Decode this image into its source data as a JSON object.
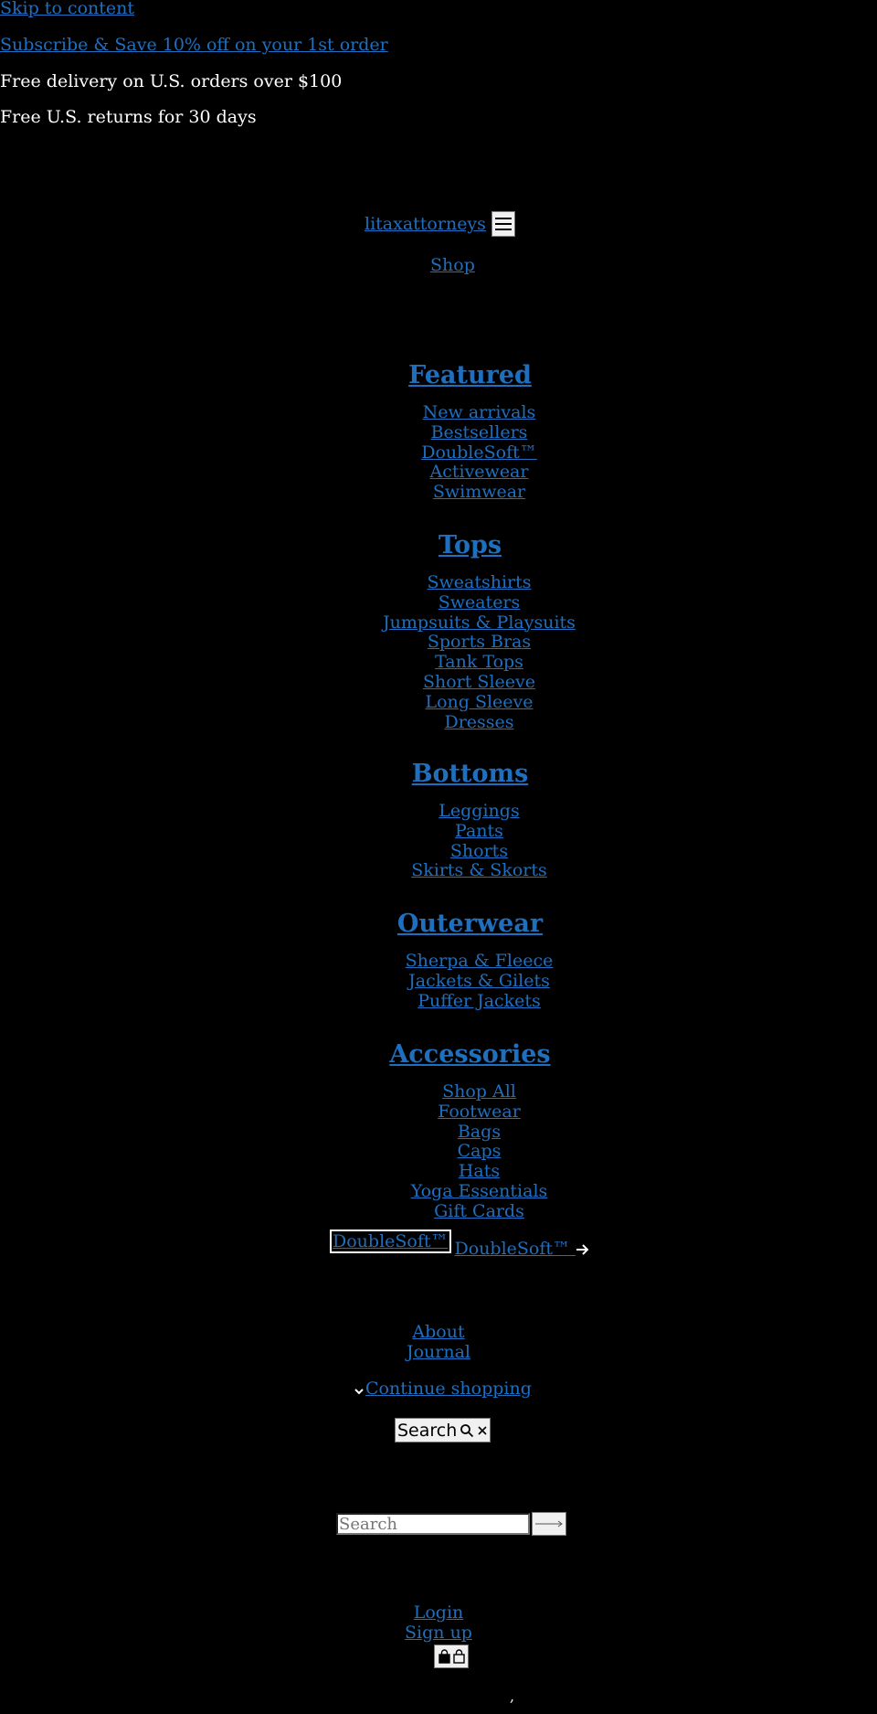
{
  "header": {
    "skip_link": "Skip to content",
    "subscribe_link": "Subscribe & Save 10% off on your 1st order",
    "delivery_text": "Free delivery on U.S. orders over $100",
    "returns_text": "Free U.S. returns for 30 days"
  },
  "brand": {
    "logo_text": "litaxattorneys",
    "menu_icon": "hamburger-icon"
  },
  "nav": {
    "shop_label": "Shop",
    "groups": [
      {
        "title": "Featured",
        "items": [
          "New arrivals",
          "Bestsellers",
          "DoubleSoft™",
          "Activewear",
          "Swimwear"
        ]
      },
      {
        "title": "Tops",
        "items": [
          "Sweatshirts",
          "Sweaters",
          "Jumpsuits & Playsuits",
          "Sports Bras",
          "Tank Tops",
          "Short Sleeve",
          "Long Sleeve",
          "Dresses"
        ]
      },
      {
        "title": "Bottoms",
        "items": [
          "Leggings",
          "Pants",
          "Shorts",
          "Skirts & Skorts"
        ]
      },
      {
        "title": "Outerwear",
        "items": [
          "Sherpa & Fleece",
          "Jackets & Gilets",
          "Puffer Jackets"
        ]
      },
      {
        "title": "Accessories",
        "items": [
          "Shop All",
          "Footwear",
          "Bags",
          "Caps",
          "Hats",
          "Yoga Essentials",
          "Gift Cards"
        ]
      }
    ],
    "promo_image_alt": "DoubleSoft™",
    "promo_link": "DoubleSoft™",
    "promo_arrow_icon": "arrow-right-icon",
    "about_label": "About",
    "journal_label": "Journal",
    "continue_label": "Continue shopping",
    "continue_icon": "chevron-down-icon"
  },
  "search": {
    "toggle_label": "Search",
    "toggle_icons": [
      "search-icon",
      "close-icon"
    ],
    "input_placeholder": "Search",
    "submit_icon": "long-arrow-right-icon"
  },
  "account": {
    "login_label": "Login",
    "signup_label": "Sign up",
    "bag_icons": [
      "shopping-bag-icon",
      "shopping-bag-icon"
    ],
    "footer_mark": ","
  },
  "colors": {
    "background": "#000000",
    "link": "#1f6fbf",
    "text": "#ffffff"
  }
}
